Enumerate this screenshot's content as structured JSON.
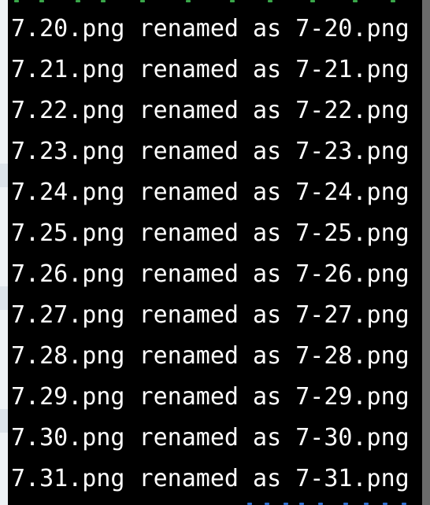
{
  "terminal": {
    "lines": [
      "7.20.png renamed as 7-20.png",
      "7.21.png renamed as 7-21.png",
      "7.22.png renamed as 7-22.png",
      "7.23.png renamed as 7-23.png",
      "7.24.png renamed as 7-24.png",
      "7.25.png renamed as 7-25.png",
      "7.26.png renamed as 7-26.png",
      "7.27.png renamed as 7-27.png",
      "7.28.png renamed as 7-28.png",
      "7.29.png renamed as 7-29.png",
      "7.30.png renamed as 7-30.png",
      "7.31.png renamed as 7-31.png"
    ],
    "background_color": "#000000",
    "text_color": "#ffffff"
  }
}
